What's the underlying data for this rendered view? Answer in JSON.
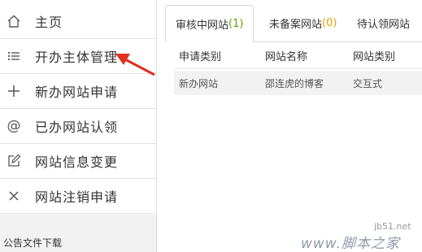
{
  "sidebar": {
    "items": [
      {
        "label": "主页",
        "icon": "home-icon"
      },
      {
        "label": "开办主体管理",
        "icon": "list-icon"
      },
      {
        "label": "新办网站申请",
        "icon": "plus-icon"
      },
      {
        "label": "已办网站认领",
        "icon": "at-icon"
      },
      {
        "label": "网站信息变更",
        "icon": "edit-icon"
      },
      {
        "label": "网站注销申请",
        "icon": "close-icon"
      }
    ],
    "notice_link": "公告文件下载"
  },
  "tabs": [
    {
      "label": "审核中网站",
      "count": "(1)"
    },
    {
      "label": "未备案网站",
      "count": "(0)"
    },
    {
      "label": "待认领网站"
    }
  ],
  "table": {
    "headers": [
      "申请类别",
      "网站名称",
      "网站类别"
    ],
    "rows": [
      [
        "新办网站",
        "邵连虎的博客",
        "交互式"
      ]
    ]
  },
  "watermark": {
    "site": "jb51.net",
    "text": "www.脚本之家"
  },
  "colors": {
    "arrow": "#e0301e",
    "count_green": "#5aa700",
    "count_orange": "#e8a200"
  }
}
